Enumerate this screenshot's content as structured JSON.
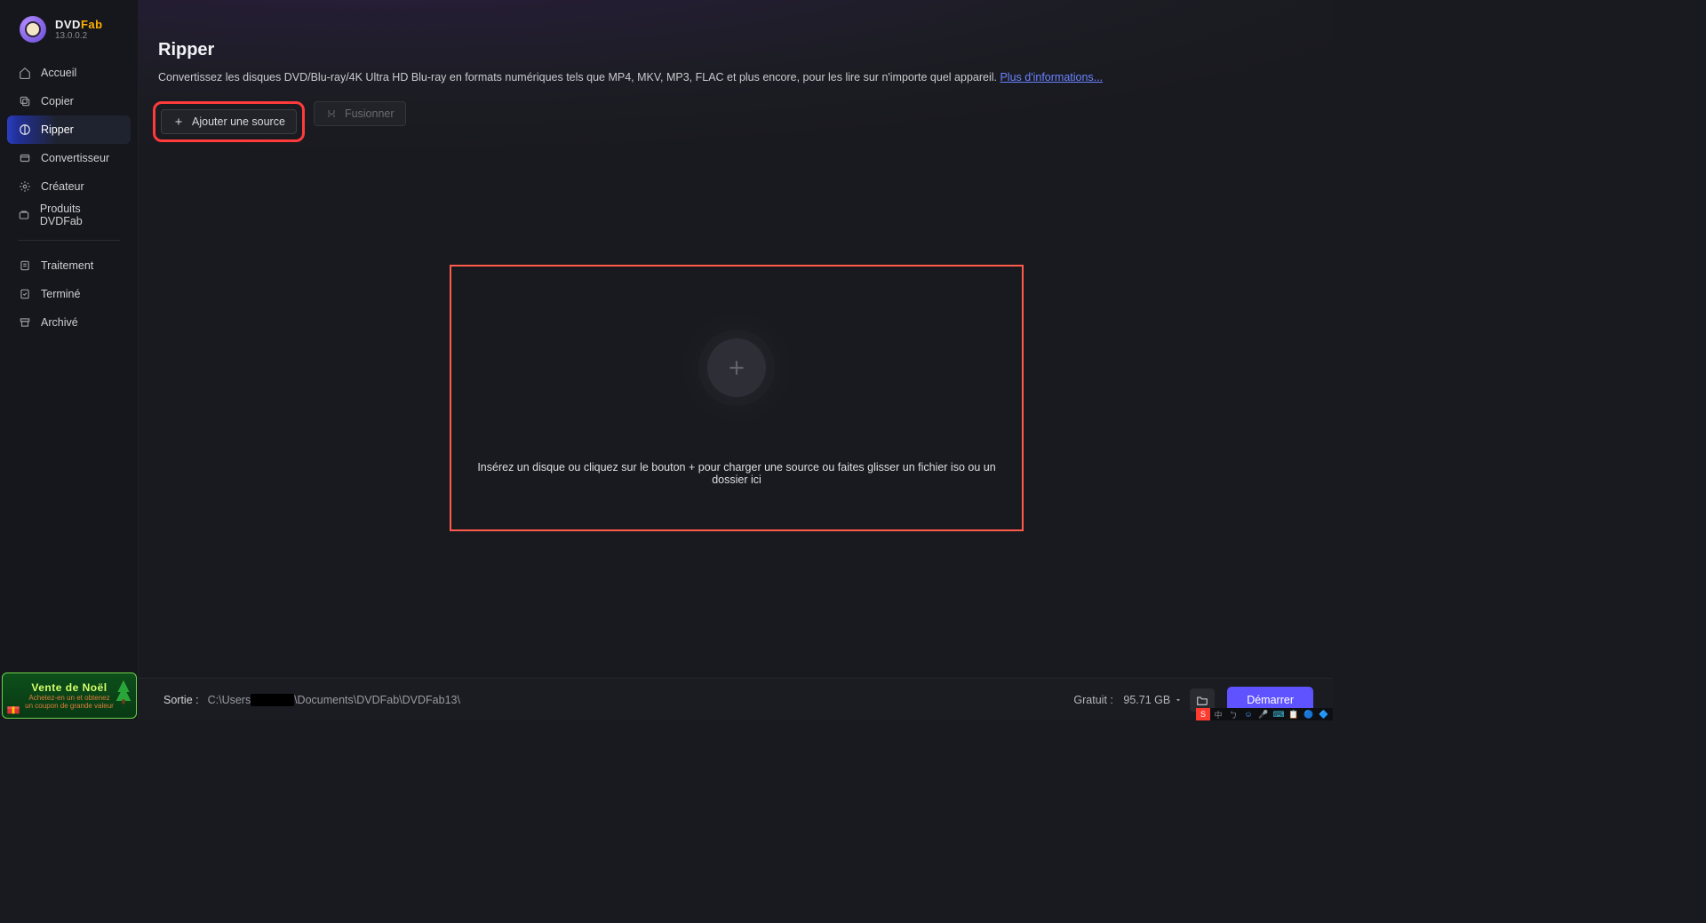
{
  "app": {
    "name": "DVD",
    "name_accent": "Fab",
    "version": "13.0.0.2"
  },
  "window_controls": {
    "pin": "pin-icon",
    "menu": "hamburger-icon",
    "minimize": "minimize-icon",
    "maximize": "maximize-icon",
    "close": "close-icon"
  },
  "sidebar": {
    "items": [
      {
        "id": "home",
        "label": "Accueil",
        "icon": "home-icon"
      },
      {
        "id": "copy",
        "label": "Copier",
        "icon": "copy-icon"
      },
      {
        "id": "ripper",
        "label": "Ripper",
        "icon": "ripper-icon",
        "active": true
      },
      {
        "id": "converter",
        "label": "Convertisseur",
        "icon": "converter-icon"
      },
      {
        "id": "creator",
        "label": "Créateur",
        "icon": "creator-icon"
      },
      {
        "id": "products",
        "label": "Produits DVDFab",
        "icon": "products-icon"
      }
    ],
    "items2": [
      {
        "id": "processing",
        "label": "Traitement",
        "icon": "task-icon"
      },
      {
        "id": "done",
        "label": "Terminé",
        "icon": "done-icon"
      },
      {
        "id": "archived",
        "label": "Archivé",
        "icon": "archive-icon"
      }
    ]
  },
  "promo": {
    "title": "Vente de Noël",
    "line1": "Achetez-en un et obtenez",
    "line2": "un coupon de grande valeur"
  },
  "page": {
    "title": "Ripper",
    "description": "Convertissez les disques DVD/Blu-ray/4K Ultra HD Blu-ray en formats numériques tels que MP4, MKV, MP3, FLAC et plus encore, pour les lire sur n'importe quel appareil. ",
    "more_link": "Plus d'informations...",
    "add_source": "Ajouter une source",
    "merge": "Fusionner",
    "drop_text": "Insérez un disque ou cliquez sur le bouton +  pour charger une source ou faites glisser un fichier iso ou un dossier ici"
  },
  "footer": {
    "output_label": "Sortie :",
    "output_path_pre": "C:\\Users",
    "output_path_post": "\\Documents\\DVDFab\\DVDFab13\\",
    "free_label": "Gratuit :",
    "free_value": "95.71 GB",
    "start": "Démarrer"
  },
  "tray": {
    "items": [
      "S",
      "中",
      "ㄅ",
      "☺",
      "🎤",
      "⌨",
      "📋",
      "🔵",
      "🔷"
    ]
  }
}
